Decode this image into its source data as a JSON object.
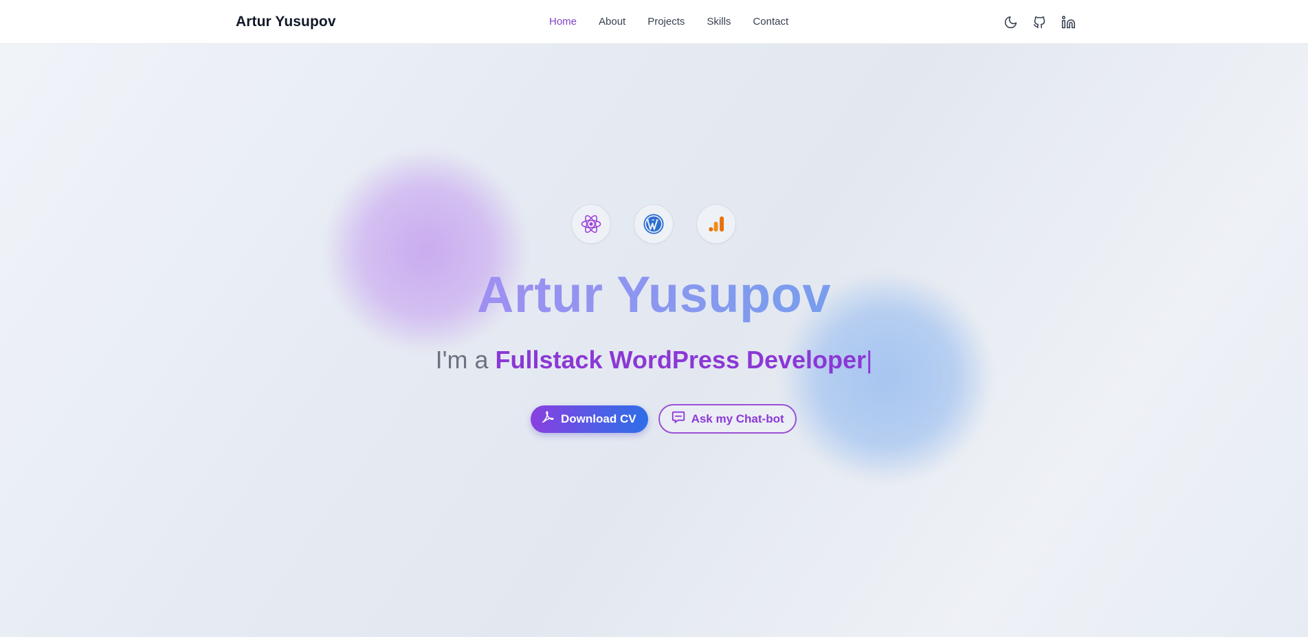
{
  "nav": {
    "brand": "Artur Yusupov",
    "links": [
      {
        "label": "Home",
        "active": true
      },
      {
        "label": "About",
        "active": false
      },
      {
        "label": "Projects",
        "active": false
      },
      {
        "label": "Skills",
        "active": false
      },
      {
        "label": "Contact",
        "active": false
      }
    ],
    "icons": [
      "moon-icon",
      "github-icon",
      "linkedin-icon"
    ]
  },
  "hero": {
    "tech_icons": [
      {
        "name": "react-icon",
        "color": "#9b3fd9"
      },
      {
        "name": "wordpress-icon",
        "color": "#2c6fd1"
      },
      {
        "name": "google-analytics-icon",
        "color": "#e8710a"
      }
    ],
    "title": "Artur Yusupov",
    "subtitle_prefix": "I'm a",
    "subtitle_role": "Fullstack WordPress Developer",
    "subtitle_cursor": "|",
    "primary_button": "Download CV",
    "secondary_button": "Ask my Chat-bot"
  },
  "colors": {
    "accent_purple": "#8b38d6",
    "accent_blue": "#2f6ee8",
    "active_nav": "#7e3fc7"
  }
}
